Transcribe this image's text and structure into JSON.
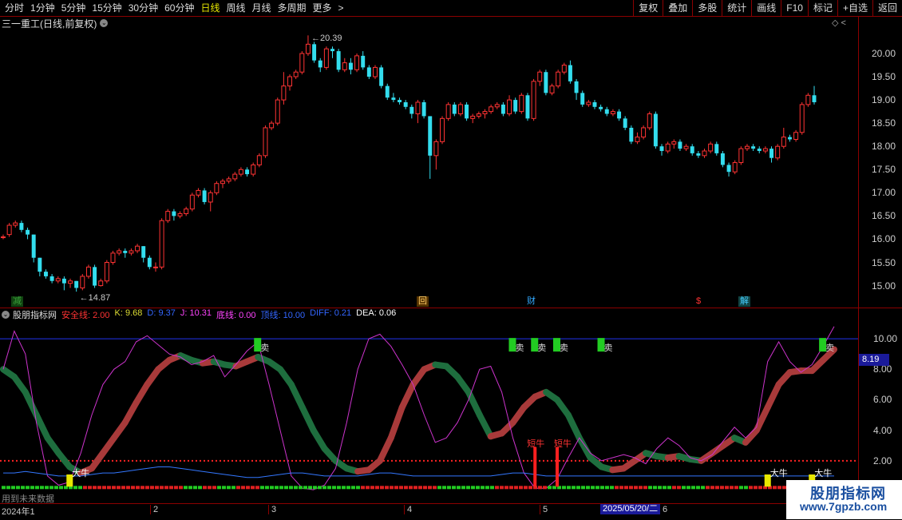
{
  "toolbar": {
    "periods": [
      "分时",
      "1分钟",
      "5分钟",
      "15分钟",
      "30分钟",
      "60分钟",
      "日线",
      "周线",
      "月线",
      "多周期",
      "更多"
    ],
    "active_period": "日线",
    "more_arrow": ">",
    "right_buttons": [
      "复权",
      "叠加",
      "多股",
      "统计",
      "画线",
      "F10",
      "标记",
      "+自选",
      "返回"
    ]
  },
  "chart": {
    "title": "三一重工(日线,前复权)",
    "chevron": "⌄",
    "right_icons": "◇ <",
    "high_label": "20.39",
    "low_label": "14.87",
    "price_axis": [
      "20.00",
      "19.50",
      "19.00",
      "18.50",
      "18.00",
      "17.50",
      "17.00",
      "16.50",
      "16.00",
      "15.50",
      "15.00"
    ],
    "events": [
      {
        "text": "减",
        "color": "#3aa03a",
        "bg": "#114411"
      },
      {
        "text": "回",
        "color": "#ffcc66",
        "bg": "#553300"
      },
      {
        "text": "财",
        "color": "#33aaff",
        "bg": "#000"
      },
      {
        "text": "$",
        "color": "#ff3333",
        "bg": "#000"
      },
      {
        "text": "解",
        "color": "#44ccff",
        "bg": "#114444"
      }
    ]
  },
  "indicator": {
    "name": "股朋指标网",
    "values": [
      {
        "label": "安全线: 2.00",
        "color": "#ff3333"
      },
      {
        "label": "K: 9.68",
        "color": "#dddd33"
      },
      {
        "label": "D: 9.37",
        "color": "#3366ff"
      },
      {
        "label": "J: 10.31",
        "color": "#ff44ff"
      },
      {
        "label": "底线: 0.00",
        "color": "#ff44ff"
      },
      {
        "label": "顶线: 10.00",
        "color": "#3366ff"
      },
      {
        "label": "DIFF: 0.21",
        "color": "#3366ff"
      },
      {
        "label": "DEA: 0.06",
        "color": "#ffffff"
      }
    ],
    "axis": [
      "10.00",
      "8.00",
      "6.00",
      "4.00",
      "2.00"
    ],
    "current_value": "8.19",
    "sell_label": "卖",
    "big_bull_label": "大牛",
    "short_bull_label": "短牛",
    "bottom_note": "用到未来数据"
  },
  "dates": {
    "labels": [
      "2024年1",
      "2",
      "3",
      "4",
      "5",
      "6"
    ],
    "highlight": "2025/05/20/二"
  },
  "watermark": {
    "line1": "股朋指标网",
    "line2": "www.7gpzb.com"
  },
  "colors": {
    "up": "#ff3333",
    "down": "#33ddee",
    "toolbar_bg": "#000000",
    "border": "#8b0000",
    "safe_line": "#ff2222",
    "top_line": "#2233ee"
  },
  "chart_data": {
    "type": "candlestick",
    "series": [
      {
        "values": [
          [
            16.05,
            16.05,
            16.1,
            16.0
          ],
          [
            16.1,
            16.3,
            16.35,
            16.05
          ],
          [
            16.3,
            16.35,
            16.4,
            16.25
          ],
          [
            16.35,
            16.2,
            16.4,
            16.15
          ],
          [
            16.2,
            16.1,
            16.25,
            16.0
          ],
          [
            16.1,
            15.6,
            16.1,
            15.5
          ],
          [
            15.6,
            15.3,
            15.6,
            15.2
          ],
          [
            15.3,
            15.2,
            15.35,
            15.15
          ],
          [
            15.2,
            15.1,
            15.25,
            15.05
          ],
          [
            15.1,
            15.15,
            15.2,
            15.05
          ],
          [
            15.15,
            15.05,
            15.2,
            14.9
          ],
          [
            15.05,
            15.1,
            15.15,
            14.95
          ],
          [
            15.1,
            14.95,
            15.1,
            14.87
          ],
          [
            14.95,
            15.2,
            15.25,
            14.9
          ],
          [
            15.2,
            15.4,
            15.45,
            15.15
          ],
          [
            15.4,
            15.0,
            15.45,
            14.95
          ],
          [
            15.0,
            15.1,
            15.15,
            14.98
          ],
          [
            15.1,
            15.5,
            15.55,
            15.05
          ],
          [
            15.5,
            15.7,
            15.75,
            15.45
          ],
          [
            15.7,
            15.75,
            15.8,
            15.65
          ],
          [
            15.75,
            15.7,
            15.8,
            15.6
          ],
          [
            15.7,
            15.75,
            15.8,
            15.65
          ],
          [
            15.75,
            15.85,
            15.9,
            15.7
          ],
          [
            15.85,
            15.6,
            15.85,
            15.5
          ],
          [
            15.6,
            15.4,
            15.65,
            15.35
          ],
          [
            15.4,
            15.4,
            15.5,
            15.3
          ],
          [
            15.4,
            16.4,
            16.45,
            15.35
          ],
          [
            16.4,
            16.6,
            16.65,
            16.35
          ],
          [
            16.6,
            16.5,
            16.65,
            16.4
          ],
          [
            16.5,
            16.55,
            16.6,
            16.45
          ],
          [
            16.55,
            16.65,
            16.7,
            16.5
          ],
          [
            16.65,
            16.95,
            17.0,
            16.6
          ],
          [
            16.95,
            17.05,
            17.1,
            16.9
          ],
          [
            17.05,
            16.8,
            17.1,
            16.75
          ],
          [
            16.8,
            17.0,
            17.05,
            16.6
          ],
          [
            17.0,
            17.2,
            17.25,
            16.95
          ],
          [
            17.2,
            17.25,
            17.3,
            17.1
          ],
          [
            17.25,
            17.3,
            17.35,
            17.2
          ],
          [
            17.3,
            17.4,
            17.45,
            17.25
          ],
          [
            17.4,
            17.5,
            17.55,
            17.35
          ],
          [
            17.5,
            17.4,
            17.55,
            17.35
          ],
          [
            17.4,
            17.6,
            17.65,
            17.35
          ],
          [
            17.6,
            17.8,
            17.85,
            17.55
          ],
          [
            17.8,
            18.4,
            18.45,
            17.75
          ],
          [
            18.4,
            18.5,
            18.55,
            18.35
          ],
          [
            18.5,
            19.0,
            19.05,
            18.45
          ],
          [
            19.0,
            19.3,
            19.6,
            18.9
          ],
          [
            19.3,
            19.5,
            19.55,
            19.2
          ],
          [
            19.5,
            19.6,
            19.65,
            19.45
          ],
          [
            19.6,
            20.0,
            20.05,
            19.55
          ],
          [
            20.0,
            20.2,
            20.39,
            19.95
          ],
          [
            20.2,
            19.85,
            20.25,
            19.8
          ],
          [
            19.85,
            19.7,
            19.9,
            19.6
          ],
          [
            19.7,
            20.1,
            20.15,
            19.65
          ],
          [
            20.1,
            20.05,
            20.15,
            19.9
          ],
          [
            20.05,
            19.65,
            20.1,
            19.6
          ],
          [
            19.65,
            19.8,
            19.9,
            19.6
          ],
          [
            19.8,
            19.65,
            19.9,
            19.55
          ],
          [
            19.65,
            19.95,
            20.0,
            19.6
          ],
          [
            19.95,
            19.7,
            20.05,
            19.65
          ],
          [
            19.7,
            19.5,
            19.75,
            19.45
          ],
          [
            19.5,
            19.7,
            19.75,
            19.45
          ],
          [
            19.7,
            19.3,
            19.75,
            19.25
          ],
          [
            19.3,
            19.05,
            19.35,
            19.0
          ],
          [
            19.05,
            19.0,
            19.15,
            18.95
          ],
          [
            19.0,
            18.95,
            19.05,
            18.9
          ],
          [
            18.95,
            18.85,
            19.0,
            18.8
          ],
          [
            18.85,
            18.7,
            18.9,
            18.6
          ],
          [
            18.7,
            18.95,
            19.0,
            18.5
          ],
          [
            18.95,
            18.65,
            19.0,
            18.6
          ],
          [
            18.65,
            17.8,
            18.65,
            17.3
          ],
          [
            17.8,
            18.1,
            18.15,
            17.5
          ],
          [
            18.1,
            18.6,
            18.65,
            18.05
          ],
          [
            18.6,
            18.9,
            18.95,
            18.55
          ],
          [
            18.9,
            18.7,
            18.95,
            18.65
          ],
          [
            18.7,
            18.9,
            18.95,
            18.65
          ],
          [
            18.9,
            18.6,
            18.95,
            18.55
          ],
          [
            18.6,
            18.65,
            18.7,
            18.5
          ],
          [
            18.65,
            18.7,
            18.75,
            18.6
          ],
          [
            18.7,
            18.75,
            18.8,
            18.6
          ],
          [
            18.75,
            18.85,
            18.9,
            18.7
          ],
          [
            18.85,
            18.9,
            18.95,
            18.8
          ],
          [
            18.9,
            18.7,
            18.95,
            18.65
          ],
          [
            18.7,
            19.0,
            19.1,
            18.65
          ],
          [
            19.0,
            18.75,
            19.05,
            18.7
          ],
          [
            18.75,
            19.1,
            19.15,
            18.7
          ],
          [
            19.1,
            18.6,
            19.15,
            18.55
          ],
          [
            18.6,
            19.4,
            19.45,
            18.55
          ],
          [
            19.4,
            19.6,
            19.65,
            19.3
          ],
          [
            19.6,
            19.15,
            19.65,
            19.1
          ],
          [
            19.15,
            19.3,
            19.35,
            19.1
          ],
          [
            19.3,
            19.6,
            19.65,
            19.25
          ],
          [
            19.6,
            19.75,
            19.8,
            19.55
          ],
          [
            19.75,
            19.4,
            19.85,
            19.35
          ],
          [
            19.4,
            19.15,
            19.45,
            19.0
          ],
          [
            19.15,
            18.9,
            19.2,
            18.85
          ],
          [
            18.9,
            18.95,
            19.0,
            18.85
          ],
          [
            18.95,
            18.85,
            19.0,
            18.8
          ],
          [
            18.85,
            18.8,
            18.9,
            18.75
          ],
          [
            18.8,
            18.7,
            18.85,
            18.65
          ],
          [
            18.7,
            18.75,
            18.8,
            18.65
          ],
          [
            18.75,
            18.6,
            18.8,
            18.55
          ],
          [
            18.6,
            18.4,
            18.65,
            18.35
          ],
          [
            18.4,
            18.1,
            18.45,
            18.05
          ],
          [
            18.1,
            18.2,
            18.3,
            18.05
          ],
          [
            18.2,
            18.4,
            18.45,
            18.15
          ],
          [
            18.4,
            18.7,
            18.75,
            18.35
          ],
          [
            18.7,
            18.0,
            18.75,
            17.95
          ],
          [
            18.0,
            17.9,
            18.05,
            17.8
          ],
          [
            17.9,
            18.05,
            18.1,
            17.85
          ],
          [
            18.05,
            18.1,
            18.15,
            17.95
          ],
          [
            18.1,
            17.95,
            18.15,
            17.9
          ],
          [
            17.95,
            18.0,
            18.05,
            17.9
          ],
          [
            18.0,
            17.85,
            18.05,
            17.8
          ],
          [
            17.85,
            17.8,
            17.9,
            17.75
          ],
          [
            17.8,
            17.9,
            17.95,
            17.75
          ],
          [
            17.9,
            18.05,
            18.1,
            17.85
          ],
          [
            18.05,
            17.85,
            18.1,
            17.8
          ],
          [
            17.85,
            17.6,
            17.9,
            17.55
          ],
          [
            17.6,
            17.45,
            17.65,
            17.35
          ],
          [
            17.45,
            17.65,
            17.7,
            17.4
          ],
          [
            17.65,
            17.95,
            18.0,
            17.6
          ],
          [
            17.95,
            18.0,
            18.05,
            17.9
          ],
          [
            18.0,
            17.95,
            18.05,
            17.9
          ],
          [
            17.95,
            17.9,
            18.0,
            17.85
          ],
          [
            17.9,
            17.95,
            18.0,
            17.85
          ],
          [
            17.95,
            17.75,
            18.0,
            17.65
          ],
          [
            17.75,
            18.0,
            18.05,
            17.7
          ],
          [
            18.0,
            18.2,
            18.4,
            17.95
          ],
          [
            18.2,
            18.15,
            18.25,
            18.1
          ],
          [
            18.15,
            18.3,
            18.35,
            18.1
          ],
          [
            18.3,
            18.9,
            18.95,
            18.25
          ],
          [
            18.9,
            19.1,
            19.15,
            18.85
          ],
          [
            19.1,
            18.95,
            19.3,
            18.9
          ]
        ]
      }
    ],
    "ylim": [
      14.7,
      20.55
    ],
    "indicator_lines": {
      "ylim": [
        0,
        11
      ],
      "safe_line": 2.0,
      "top_line": 10.0,
      "bottom_line": 0.0,
      "trend_band_upper": [
        8,
        7.5,
        6.5,
        5,
        3.5,
        2.5,
        1.6,
        1.2,
        1.5,
        2.5,
        3.5,
        4.5,
        5.8,
        7,
        8,
        8.6,
        8.9,
        8.6,
        8.4,
        8.5,
        8.3,
        8.2,
        8.5,
        8.8,
        8.5,
        8.0,
        7.0,
        5.5,
        4.0,
        2.8,
        2.0,
        1.5,
        1.3,
        1.4,
        2.0,
        3.5,
        5.5,
        7.0,
        8.0,
        8.3,
        8.2,
        7.5,
        6.5,
        5.0,
        3.6,
        3.8,
        4.5,
        5.5,
        6.2,
        6.5,
        6.0,
        5.0,
        3.5,
        2.2,
        1.6,
        1.4,
        1.5,
        2.0,
        2.5,
        2.3,
        2.2,
        2.3,
        2.1,
        2.0,
        2.5,
        3.0,
        3.5,
        3.2,
        4.0,
        5.5,
        7.0,
        7.8,
        7.9,
        7.9,
        8.6,
        9.3
      ],
      "stick_line": [
        1.2,
        1.2,
        1.3,
        1.2,
        1.1,
        1.0,
        1.0,
        1.0,
        1.1,
        1.2,
        1.2,
        1.3,
        1.4,
        1.5,
        1.6,
        1.6,
        1.5,
        1.4,
        1.3,
        1.2,
        1.1,
        1.0,
        0.9,
        0.9,
        1.0,
        1.1,
        1.2,
        1.2,
        1.1,
        1.0,
        1.0,
        1.0,
        1.0,
        1.1,
        1.2,
        1.2,
        1.1,
        1.0,
        1.0,
        1.0,
        1.0,
        1.0,
        1.0,
        1.0,
        1.0,
        1.1,
        1.2,
        1.2,
        1.1,
        1.0,
        1.0,
        1.0,
        1.0,
        1.0,
        1.0,
        1.0,
        1.0,
        1.0,
        1.0,
        1.0,
        1.0,
        1.0,
        1.0,
        1.0,
        1.0,
        1.0,
        1.0,
        1.0,
        1.0,
        1.0,
        1.0,
        1.0,
        1.0,
        1.0,
        1.0,
        1.0
      ],
      "j_line": [
        8,
        10.5,
        9,
        4.5,
        1.0,
        0.4,
        0.6,
        2.5,
        5,
        7,
        8,
        8.5,
        9.8,
        10.2,
        9.6,
        9.0,
        8.8,
        8.3,
        8.5,
        8.9,
        7.5,
        8.3,
        9.2,
        9.8,
        7.0,
        4.0,
        1.0,
        0.2,
        0.1,
        0.4,
        1.5,
        4.5,
        8.0,
        10.0,
        10.3,
        9.5,
        8.3,
        7.0,
        5.0,
        3.2,
        3.5,
        4.5,
        6.0,
        8.0,
        8.2,
        6.5,
        3.5,
        1.2,
        0.2,
        0.2,
        0.8,
        2.2,
        3.5,
        2.5,
        2.0,
        2.2,
        2.4,
        2.2,
        1.8,
        2.8,
        3.5,
        3.0,
        2.2,
        2.0,
        2.4,
        3.3,
        4.2,
        3.5,
        4.2,
        8.5,
        9.8,
        8.5,
        7.8,
        8.3,
        9.5,
        10.8
      ]
    },
    "signals": {
      "sell_at_index": [
        23,
        46,
        48,
        50,
        54,
        74
      ],
      "big_bull_index": [
        6,
        69,
        73
      ],
      "short_bull_index": [
        48,
        50
      ]
    }
  }
}
